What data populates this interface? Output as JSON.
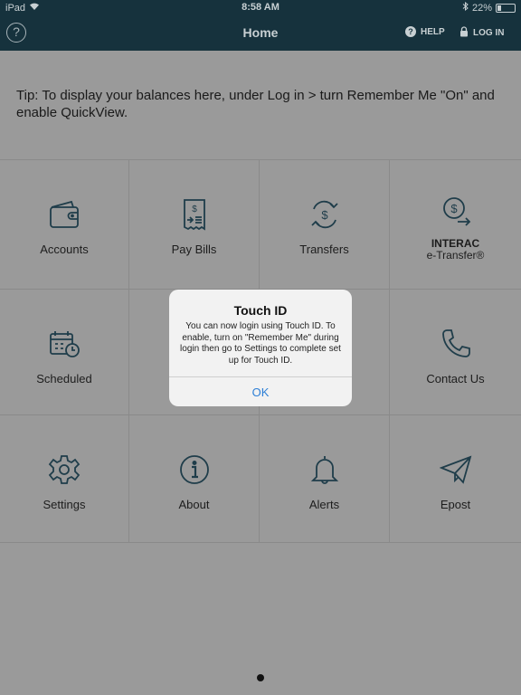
{
  "status_bar": {
    "device": "iPad",
    "time": "8:58 AM",
    "battery_percent_text": "22%",
    "battery_level": 0.22
  },
  "nav": {
    "help_symbol": "?",
    "title": "Home",
    "help_label": "HELP",
    "login_label": "LOG IN"
  },
  "tip": "Tip: To display your balances here, under Log in > turn Remember Me \"On\" and enable QuickView.",
  "tiles": [
    {
      "label": "Accounts",
      "icon": "wallet-icon"
    },
    {
      "label": "Pay Bills",
      "icon": "bill-receipt-icon"
    },
    {
      "label": "Transfers",
      "icon": "transfer-arrows-icon"
    },
    {
      "label_line1": "INTERAC",
      "label_line2": "e-Transfer®",
      "icon": "e-transfer-icon"
    },
    {
      "label": "Scheduled",
      "icon": "calendar-clock-icon"
    },
    {
      "label": "",
      "icon": ""
    },
    {
      "label": "",
      "icon": ""
    },
    {
      "label": "Contact Us",
      "icon": "phone-icon"
    },
    {
      "label": "Settings",
      "icon": "gear-icon"
    },
    {
      "label": "About",
      "icon": "info-icon"
    },
    {
      "label": "Alerts",
      "icon": "bell-icon"
    },
    {
      "label": "Epost",
      "icon": "paper-plane-icon"
    }
  ],
  "dialog": {
    "title": "Touch ID",
    "message": "You can now login using Touch ID. To enable, turn on \"Remember Me\" during login then go to Settings to complete set up for Touch ID.",
    "ok_label": "OK"
  },
  "colors": {
    "nav_bg": "#16323d",
    "overlay_bg": "#9a9a9a",
    "icon_color": "#1f3d4a",
    "dialog_button": "#2d7fd6"
  }
}
